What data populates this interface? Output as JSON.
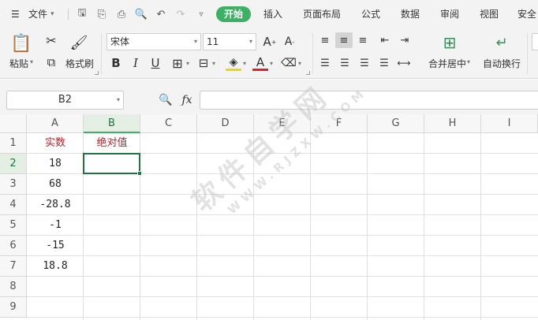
{
  "menubar": {
    "file_label": "文件",
    "tabs": [
      "开始",
      "插入",
      "页面布局",
      "公式",
      "数据",
      "审阅",
      "视图",
      "安全"
    ]
  },
  "ribbon": {
    "paste_label": "粘贴",
    "format_painter_label": "格式刷",
    "font_name": "宋体",
    "font_size": "11",
    "merge_center_label": "合并居中",
    "wrap_text_label": "自动换行"
  },
  "formula_bar": {
    "name_box": "B2",
    "fx_symbol": "fx",
    "formula": ""
  },
  "sheet": {
    "columns": [
      "A",
      "B",
      "C",
      "D",
      "E",
      "F",
      "G",
      "H",
      "I"
    ],
    "rows": [
      "1",
      "2",
      "3",
      "4",
      "5",
      "6",
      "7",
      "8",
      "9"
    ],
    "cells": {
      "A1": "实数",
      "B1": "绝对值",
      "A2": "18",
      "A3": "68",
      "A4": "-28.8",
      "A5": "-1",
      "A6": "-15",
      "A7": "18.8"
    },
    "active_cell": "B2",
    "header_text_color": "#c0202a",
    "selection_color": "#217346"
  },
  "watermark": {
    "main": "软件自学网",
    "sub": "WWW.RJZXW.COM"
  },
  "colors": {
    "active_tab": "#3cb063",
    "ribbon_bg": "#f3f3f3"
  }
}
